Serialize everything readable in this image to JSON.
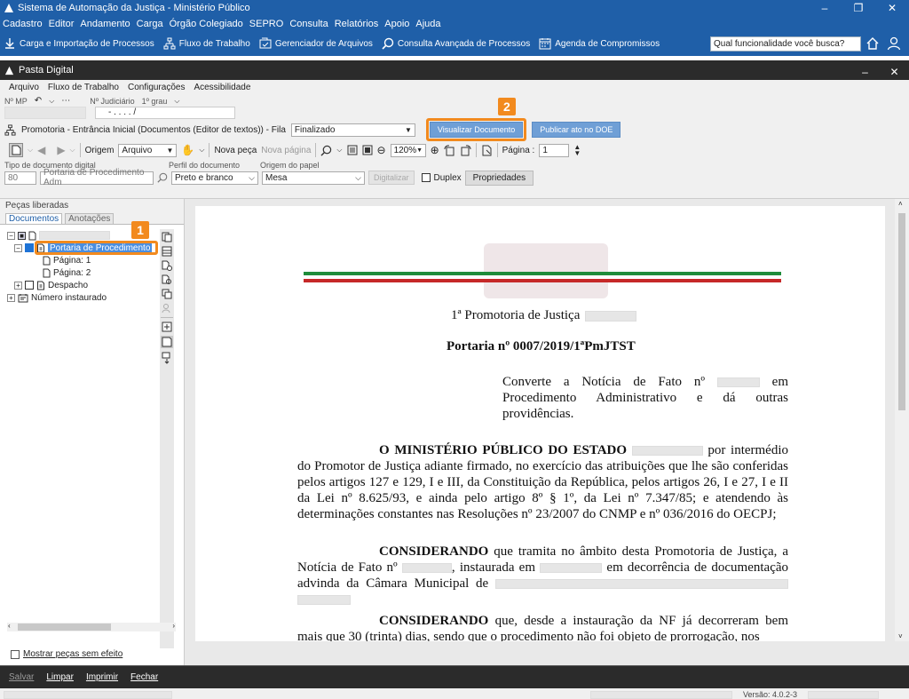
{
  "app": {
    "title": "Sistema de Automação da Justiça - Ministério Público",
    "window_buttons": [
      "–",
      "❐",
      "✕"
    ]
  },
  "main_menu": [
    "Cadastro",
    "Editor",
    "Andamento",
    "Carga",
    "Órgão Colegiado",
    "SEPRO",
    "Consulta",
    "Relatórios",
    "Apoio",
    "Ajuda"
  ],
  "quickbar": {
    "items": [
      {
        "label": "Carga e Importação de Processos",
        "icon": "download-icon"
      },
      {
        "label": "Fluxo de Trabalho",
        "icon": "flow-icon"
      },
      {
        "label": "Gerenciador de Arquivos",
        "icon": "file-manager-icon"
      },
      {
        "label": "Consulta Avançada de Processos",
        "icon": "search-icon"
      },
      {
        "label": "Agenda de Compromissos",
        "icon": "calendar-icon"
      }
    ],
    "search_placeholder": "Qual funcionalidade você busca?"
  },
  "child": {
    "title": "Pasta Digital",
    "window_buttons": [
      "–",
      "✕"
    ],
    "menu": [
      "Arquivo",
      "Fluxo de Trabalho",
      "Configurações",
      "Acessibilidade"
    ],
    "mp_label": "Nº MP",
    "judicial_label": "Nº Judiciário",
    "grau_label": "1º grau",
    "judicial_value": "- .  .  .  . /",
    "flow_label": "Promotoria - Entrância Inicial (Documentos (Editor de textos)) - Fila",
    "flow_value": "Finalizado",
    "btn_visualizar": "Visualizar Documento",
    "btn_publicar": "Publicar ato no DOE",
    "badge2": "2",
    "origem_label": "Origem",
    "origem_value": "Arquivo",
    "nova_peca": "Nova peça",
    "nova_pagina": "Nova página",
    "zoom": "120%",
    "pagina_label": "Página :",
    "pagina_value": "1",
    "tipo_label": "Tipo de documento digital",
    "perfil_label": "Perfil do documento",
    "origem_papel_label": "Origem do papel",
    "tipo_code": "80",
    "tipo_value": "Portaria de Procedimento Adm",
    "perfil_value": "Preto e branco",
    "papel_value": "Mesa",
    "digitalizar": "Digitalizar",
    "duplex": "Duplex",
    "propriedades": "Propriedades"
  },
  "left": {
    "title": "Peças liberadas",
    "tabs": [
      "Documentos",
      "Anotações"
    ],
    "badge1": "1",
    "tree": {
      "item1": "Portaria de Procedimento",
      "page1": "Página: 1",
      "page2": "Página: 2",
      "despacho": "Despacho",
      "numero": "Número instaurado"
    },
    "mostrar": "Mostrar peças sem efeito"
  },
  "document": {
    "promotoria": "1ª Promotoria de Justiça",
    "portaria": "Portaria nº 0007/2019/1ªPmJTST",
    "ementa_1": "Converte a Notícia de Fato nº",
    "ementa_2": "em Procedimento Administrativo e dá outras providências.",
    "p1_bold": "O MINISTÉRIO PÚBLICO DO ESTADO",
    "p1_text": "por intermédio do Promotor de Justiça adiante firmado, no exercício das atribuições que lhe são conferidas pelos artigos 127 e 129, I e III, da Constituição da República, pelos artigos 26, I e 27, I e II da Lei nº 8.625/93, e ainda pelo artigo 8º § 1º, da Lei nº 7.347/85; e atendendo às determinações constantes nas Resoluções nº 23/2007 do CNMP e nº 036/2016 do OECPJ;",
    "p2_bold": "CONSIDERANDO",
    "p2_a": "que tramita no âmbito desta Promotoria de Justiça, a Notícia de Fato nº",
    "p2_b": ", instaurada em",
    "p2_c": "em decorrência de documentação advinda da Câmara Municipal de",
    "p3_bold": "CONSIDERANDO",
    "p3_text": "que, desde a instauração da NF já decorreram bem mais que 30 (trinta) dias, sendo que o procedimento não foi objeto de prorrogação, nos"
  },
  "bottom": [
    "Salvar",
    "Limpar",
    "Imprimir",
    "Fechar"
  ],
  "status": {
    "version": "Versão: 4.0.2-3"
  },
  "colors": {
    "accent": "#1f5fa8",
    "highlight": "#f28a1e",
    "button": "#6f9fd6"
  }
}
